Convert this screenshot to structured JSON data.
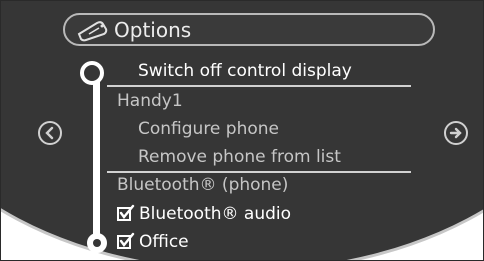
{
  "header": {
    "title": "Options",
    "icon": "phone-icon"
  },
  "menu": {
    "items": [
      {
        "label": "Switch off control display",
        "state": "selected"
      },
      {
        "label": "Handy1",
        "state": "heading"
      },
      {
        "label": "Configure phone",
        "state": "sub"
      },
      {
        "label": "Remove phone from list",
        "state": "sub"
      },
      {
        "label": "Bluetooth® (phone)",
        "state": "heading"
      },
      {
        "label": "Bluetooth® audio",
        "state": "checked"
      },
      {
        "label": "Office",
        "state": "checked"
      }
    ]
  },
  "nav": {
    "left_icon": "arrow-left-icon",
    "right_icon": "arrow-right-icon"
  },
  "colors": {
    "screen_bg": "#363636",
    "text": "#ffffff",
    "muted_text": "#c6c6c6",
    "border": "#b9b9b9"
  }
}
